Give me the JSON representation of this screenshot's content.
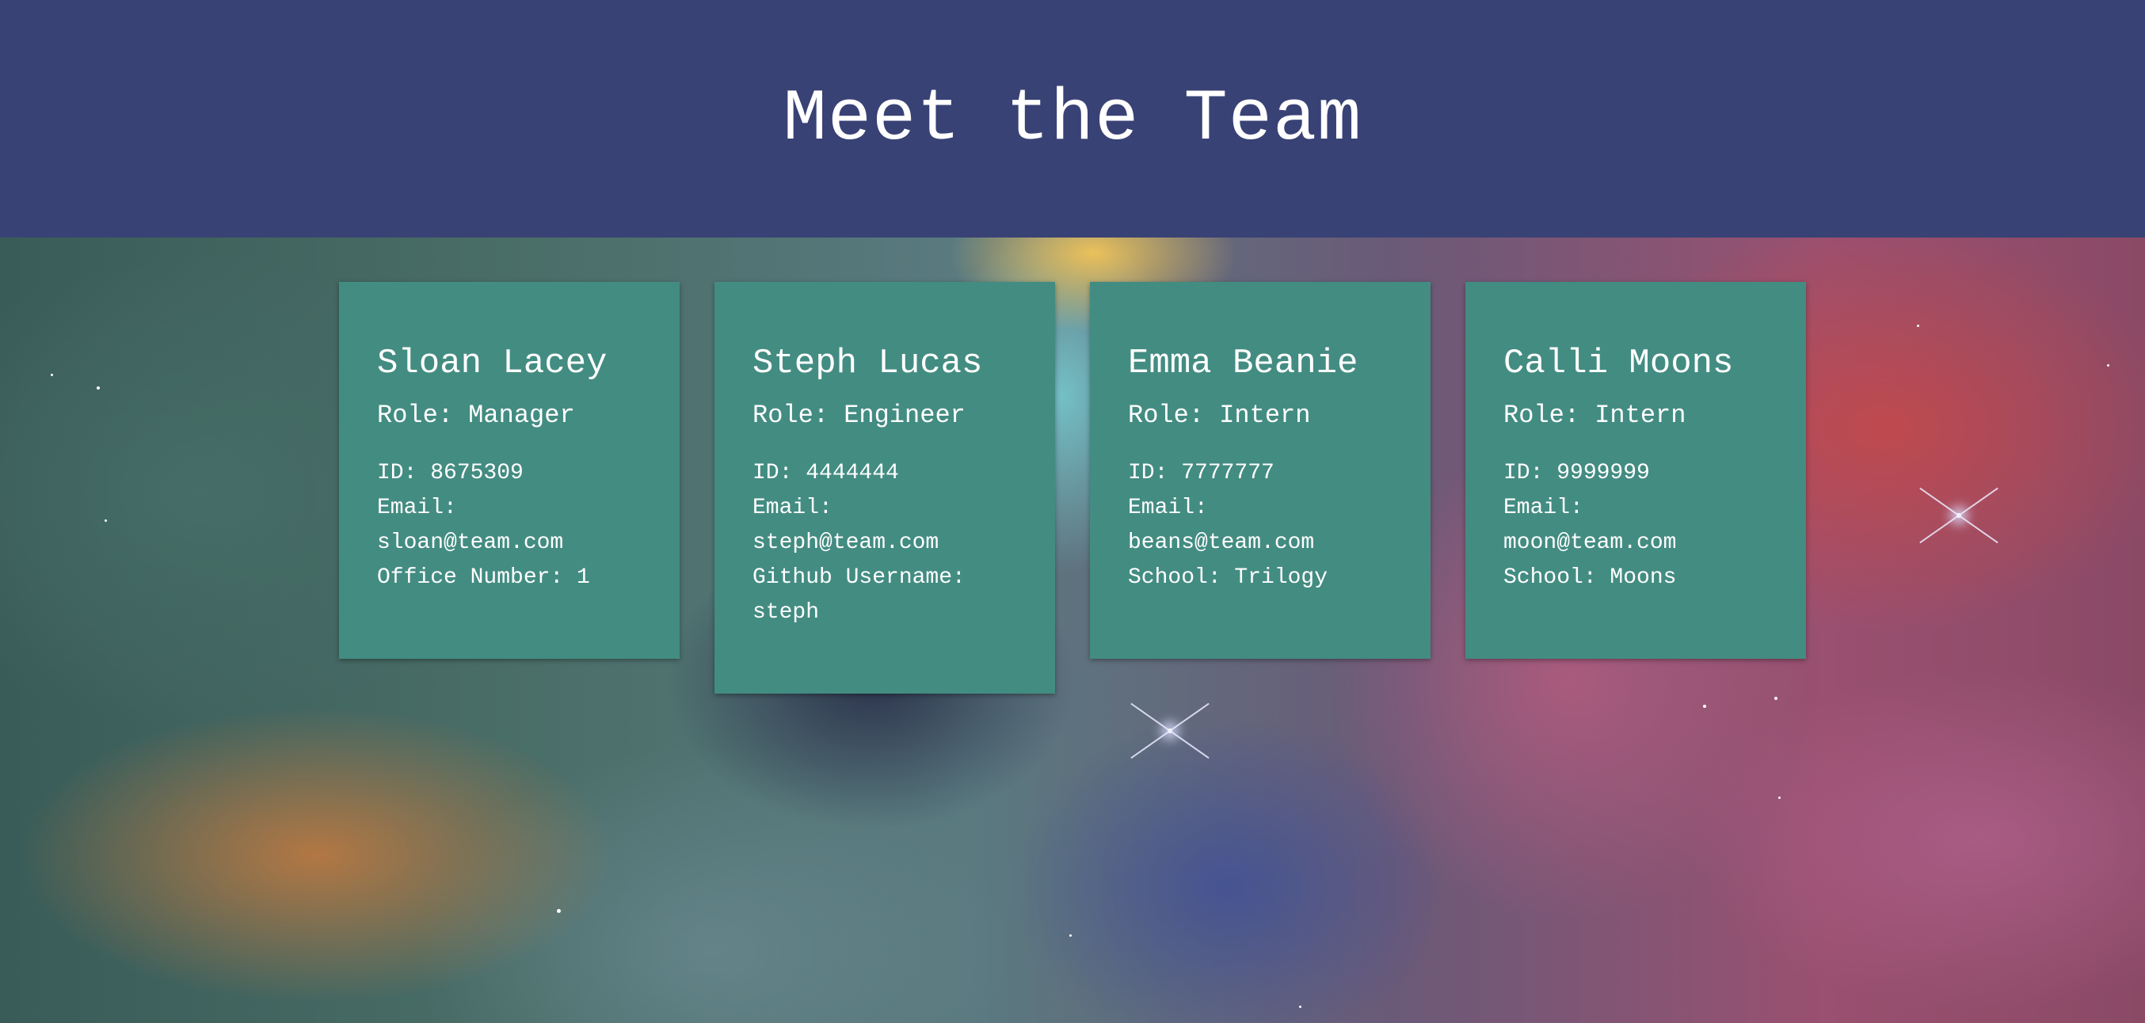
{
  "page_title": "Meet the Team",
  "colors": {
    "header_bg": "#394275",
    "card_bg": "#438c82",
    "text": "#ffffff"
  },
  "team": [
    {
      "name": "Sloan Lacey",
      "role": "Role: Manager",
      "id": "ID: 8675309",
      "email_label": "Email:",
      "email": "sloan@team.com",
      "extra": "Office Number: 1"
    },
    {
      "name": "Steph Lucas",
      "role": "Role: Engineer",
      "id": "ID: 4444444",
      "email_label": "Email:",
      "email": "steph@team.com",
      "extra_label": "Github Username:",
      "extra": "steph"
    },
    {
      "name": "Emma Beanie",
      "role": "Role: Intern",
      "id": "ID: 7777777",
      "email_label": "Email:",
      "email": "beans@team.com",
      "extra": "School: Trilogy"
    },
    {
      "name": "Calli Moons",
      "role": "Role: Intern",
      "id": "ID: 9999999",
      "email_label": "Email:",
      "email": "moon@team.com",
      "extra": "School: Moons"
    }
  ]
}
